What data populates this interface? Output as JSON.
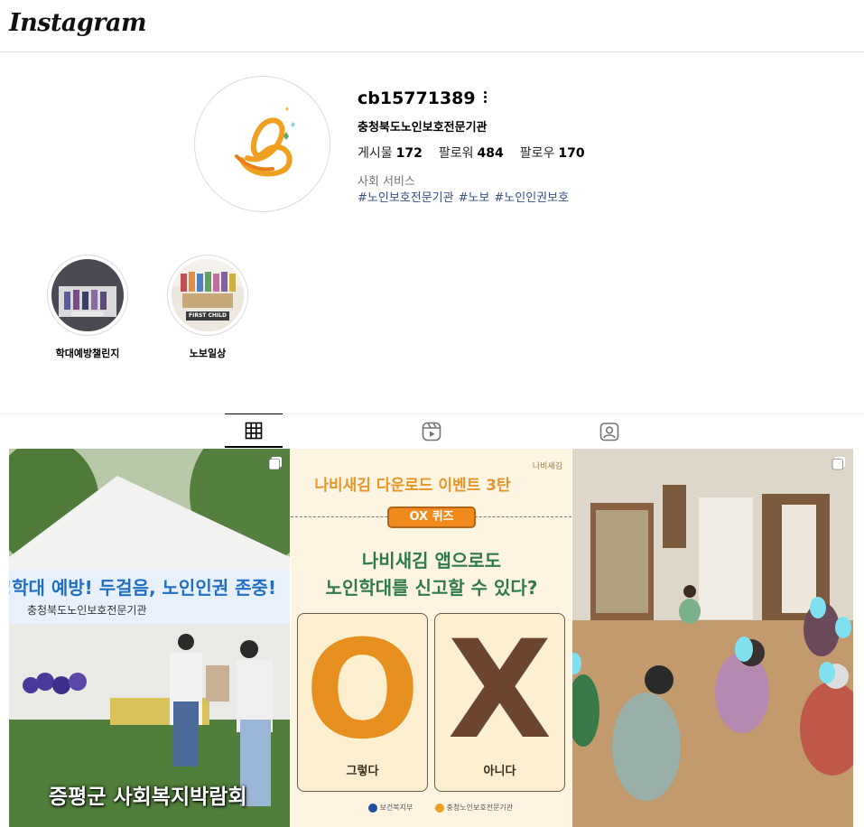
{
  "app": {
    "logo": "Instagram"
  },
  "profile": {
    "username": "cb15771389",
    "full_name": "충청북도노인보호전문기관",
    "stats": [
      {
        "label": "게시물",
        "value": "172"
      },
      {
        "label": "팔로워",
        "value": "484"
      },
      {
        "label": "팔로우",
        "value": "170"
      }
    ],
    "category": "사회 서비스",
    "hashtags": [
      "#노인보호전문기관",
      "#노보",
      "#노인인권보호"
    ]
  },
  "highlights": [
    {
      "label": "학대예방챌린지"
    },
    {
      "label": "노보일상",
      "badge": "FIRST CHILD"
    }
  ],
  "tabs": [
    {
      "icon": "grid-icon",
      "active": true
    },
    {
      "icon": "reels-icon",
      "active": false
    },
    {
      "icon": "tagged-icon",
      "active": false
    }
  ],
  "posts": {
    "p1": {
      "slogan": "!학대 예방! 두걸음, 노인인권 존중!",
      "org": "충청북도노인보호전문기관",
      "caption": "증평군 사회복지박람회"
    },
    "p2": {
      "title": "나비새김 다운로드 이벤트 3탄",
      "brand": "나비새김",
      "quiz_badge": "OX 퀴즈",
      "question_line1": "나비새김 앱으로도",
      "question_line2": "노인학대를 신고할 수 있다?",
      "o_letter": "O",
      "x_letter": "X",
      "o_label": "그렇다",
      "x_label": "아니다",
      "footer_left": "보건복지부",
      "footer_right": "충청노인보호전문기관"
    }
  },
  "colors": {
    "link": "#385185",
    "brand_orange": "#e8952a",
    "quiz_green": "#2e7a4e",
    "o_orange": "#e8901f",
    "x_brown": "#6b4530"
  }
}
